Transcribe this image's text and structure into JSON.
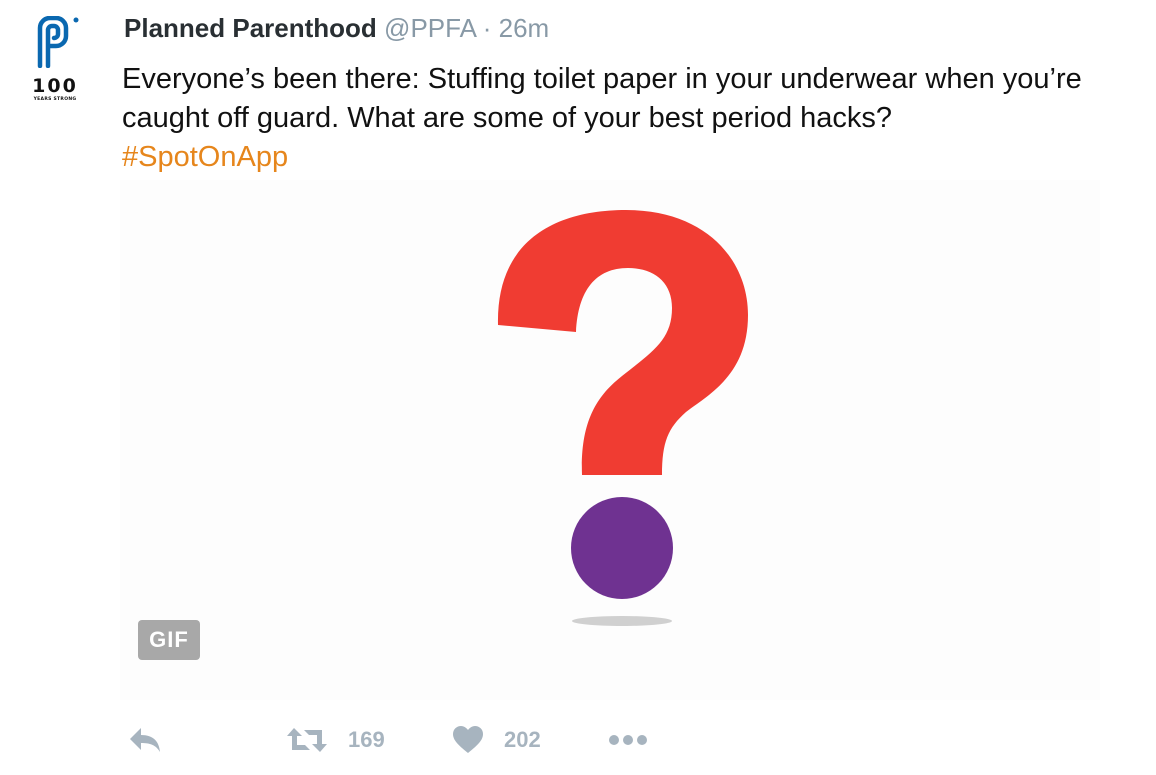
{
  "avatar": {
    "hundred_text": "100",
    "sub_text": "YEARS STRONG",
    "icon": "planned-parenthood-logo"
  },
  "header": {
    "display_name": "Planned Parenthood",
    "handle": "@PPFA",
    "separator": "·",
    "time": "26m"
  },
  "tweet": {
    "text": "Everyone’s been there: Stuffing toilet paper in your underwear when you’re caught off guard. What are some of your best period hacks?",
    "hashtag": "#SpotOnApp"
  },
  "media": {
    "badge": "GIF",
    "question_color": "#f03c32",
    "dot_color": "#6f3291",
    "shadow_color": "#d0d0d0"
  },
  "actions": {
    "reply_icon": "reply-icon",
    "retweet_icon": "retweet-icon",
    "retweet_count": "169",
    "like_icon": "heart-icon",
    "like_count": "202",
    "more_icon": "more-icon"
  },
  "colors": {
    "brand_blue": "#0a68b0",
    "hashtag": "#e6861c",
    "meta_gray": "#8899a6",
    "action_gray": "#a7b4bf"
  }
}
